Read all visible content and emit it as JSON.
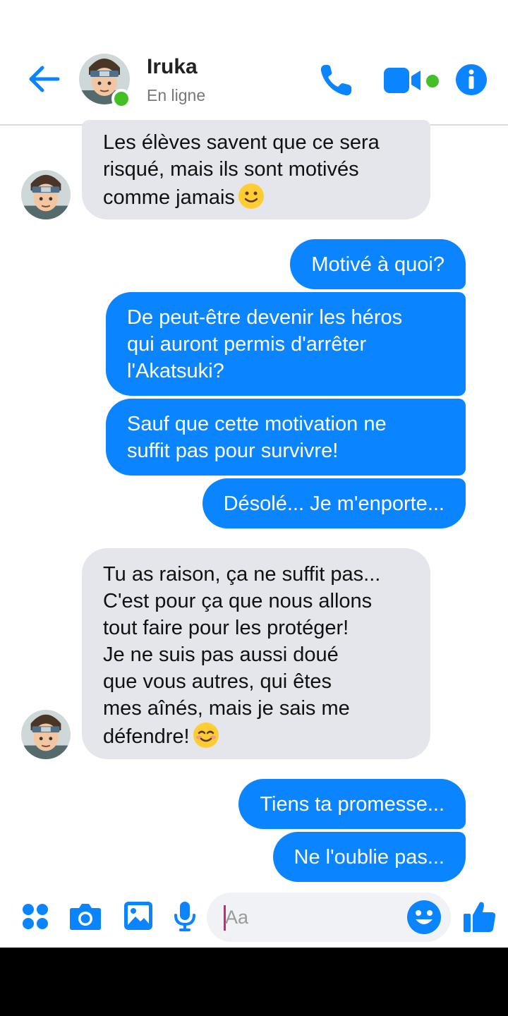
{
  "header": {
    "back_icon": "arrow-left-icon",
    "contact_name": "Iruka",
    "status": "En ligne",
    "call_icon": "phone-icon",
    "video_icon": "video-camera-icon",
    "info_icon": "info-icon"
  },
  "messages": [
    {
      "direction": "in",
      "text": "Les élèves savent que ce sera\nrisqué, mais ils sont motivés\ncomme jamais",
      "emoji": "slightly-smiling-face-icon"
    },
    {
      "direction": "out",
      "text": "Motivé à quoi?"
    },
    {
      "direction": "out",
      "text": "De peut-être devenir les héros\nqui auront permis d'arrêter\nl'Akatsuki?"
    },
    {
      "direction": "out",
      "text": "Sauf que cette motivation ne\nsuffit pas pour survivre!"
    },
    {
      "direction": "out",
      "text": "Désolé... Je m'enporte..."
    },
    {
      "direction": "in",
      "text": "Tu as raison, ça ne suffit pas...\nC'est pour ça que nous allons\ntout faire pour les protéger!\nJe ne suis pas aussi doué\nque vous autres, qui êtes\nmes aînés, mais je sais me\ndéfendre!",
      "emoji": "smiling-face-with-smiling-eyes-icon"
    },
    {
      "direction": "out",
      "text": "Tiens ta promesse..."
    },
    {
      "direction": "out",
      "text": "Ne l'oublie pas..."
    }
  ],
  "composer": {
    "placeholder": "Aa",
    "icons": [
      "apps-grid-icon",
      "camera-icon",
      "gallery-icon",
      "microphone-icon",
      "emoji-icon",
      "thumbs-up-icon"
    ]
  },
  "colors": {
    "accent": "#0a84ff",
    "incoming_bubble": "#e4e6eb",
    "online": "#44c026"
  }
}
